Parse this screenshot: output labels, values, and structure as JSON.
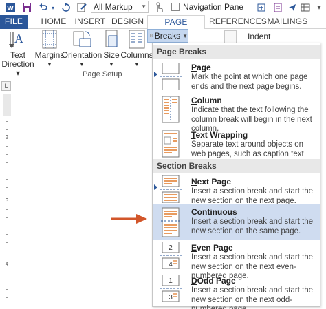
{
  "quick_access": {
    "markup_combo": "All Markup",
    "navigation_pane_label": "Navigation Pane"
  },
  "tabs": [
    {
      "label": "FILE"
    },
    {
      "label": "HOME"
    },
    {
      "label": "INSERT"
    },
    {
      "label": "DESIGN"
    },
    {
      "label": "PAGE LAYOUT"
    },
    {
      "label": "REFERENCES"
    },
    {
      "label": "MAILINGS"
    }
  ],
  "ribbon": {
    "text_direction": {
      "line1": "Text",
      "line2": "Direction"
    },
    "margins": "Margins",
    "orientation": "Orientation",
    "size": "Size",
    "columns": "Columns",
    "group_label": "Page Setup",
    "breaks": "Breaks",
    "indent": "Indent"
  },
  "ruler": {
    "corner": "L",
    "numbers": [
      "2",
      "3",
      "4"
    ]
  },
  "menu": {
    "page_breaks_header": "Page Breaks",
    "section_breaks_header": "Section Breaks",
    "items": [
      {
        "title_ul": "P",
        "title_rest": "age",
        "desc": "Mark the point at which one page ends and the next page begins.",
        "icon": "page-break-icon"
      },
      {
        "title_ul": "C",
        "title_rest": "olumn",
        "desc": "Indicate that the text following the column break will begin in the next column.",
        "icon": "column-break-icon"
      },
      {
        "title_ul": "T",
        "title_rest": "ext Wrapping",
        "desc": "Separate text around objects on web pages, such as caption text from body text.",
        "icon": "text-wrapping-icon"
      },
      {
        "title_ul": "N",
        "title_rest": "ext Page",
        "desc": "Insert a section break and start the new section on the next page.",
        "icon": "next-page-icon"
      },
      {
        "title_ul": "O",
        "title_rest": "Continuous",
        "desc": "Insert a section break and start the new section on the same page.",
        "icon": "continuous-icon"
      },
      {
        "title_ul": "E",
        "title_rest": "ven Page",
        "desc": "Insert a section break and start the new section on the next even-numbered page.",
        "icon": "even-page-icon"
      },
      {
        "title_ul": "D",
        "title_rest": "Odd Page",
        "desc": "Insert a section break and start the new section on the next odd-numbered page.",
        "icon": "odd-page-icon"
      }
    ],
    "icon_numbers": {
      "even_top": "2",
      "even_bottom": "4",
      "odd_top": "1",
      "odd_bottom": "3"
    }
  },
  "colors": {
    "accent": "#2b579a",
    "highlight": "#cfdcf0",
    "arrow": "#d2562a"
  }
}
